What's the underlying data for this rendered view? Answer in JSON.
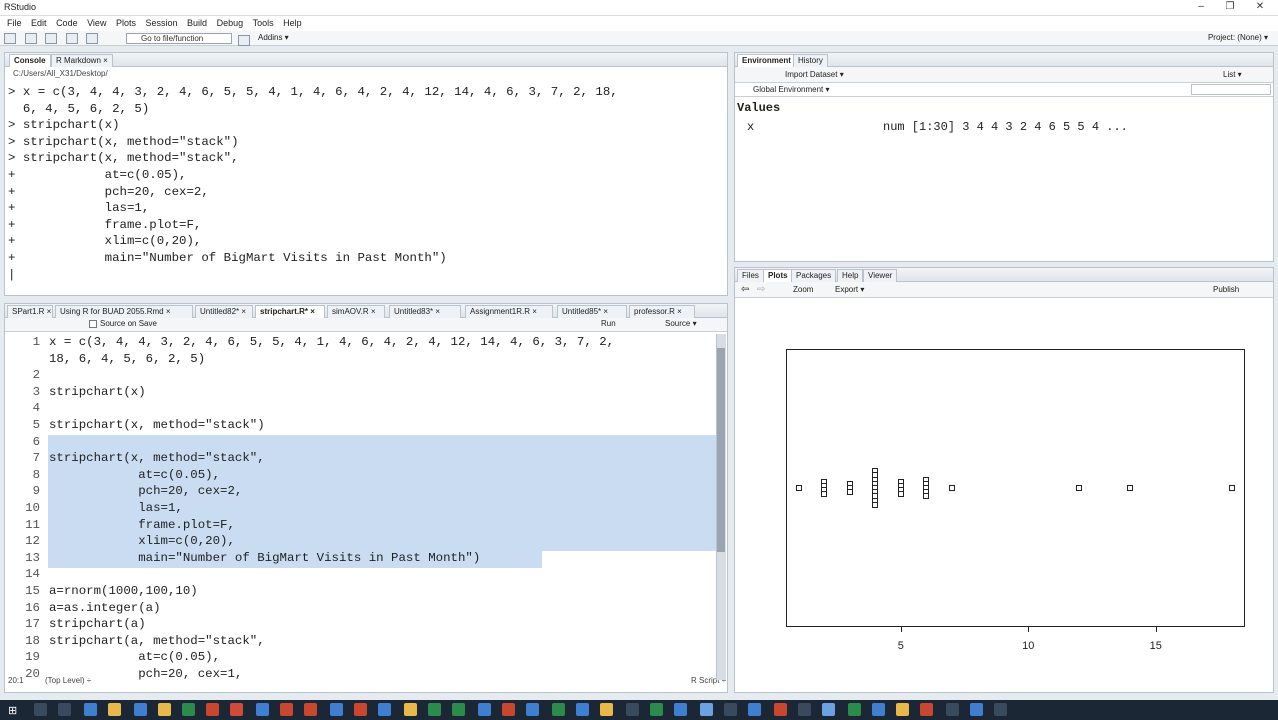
{
  "window": {
    "title": "RStudio",
    "minimize": "–",
    "maximize": "❐",
    "close": "✕"
  },
  "menu": [
    "File",
    "Edit",
    "Code",
    "View",
    "Plots",
    "Session",
    "Build",
    "Debug",
    "Tools",
    "Help"
  ],
  "toolbar": {
    "goto_label": "Go to file/function",
    "addins_label": "Addins ▾",
    "projects_label": "Project: (None) ▾"
  },
  "console": {
    "tabs": [
      "Console",
      "R Markdown ×"
    ],
    "path": "C:/Users/All_X31/Desktop/",
    "lines": [
      "> x = c(3, 4, 4, 3, 2, 4, 6, 5, 5, 4, 1, 4, 6, 4, 2, 4, 12, 14, 4, 6, 3, 7, 2, 18,",
      "  6, 4, 5, 6, 2, 5)",
      "> stripchart(x)",
      "> stripchart(x, method=\"stack\")",
      "> stripchart(x, method=\"stack\",",
      "+            at=c(0.05),",
      "+            pch=20, cex=2,",
      "+            las=1,",
      "+            frame.plot=F,",
      "+            xlim=c(0,20),",
      "+            main=\"Number of BigMart Visits in Past Month\")",
      "|"
    ]
  },
  "editor": {
    "tabs": [
      "SPart1.R ×",
      "Using R for BUAD 2055.Rmd ×",
      "Untitled82* ×",
      "stripchart.R* ×",
      "simAOV.R ×",
      "Untitled83* ×",
      "Assignment1R.R ×",
      "Untitled85* ×",
      "professor.R ×"
    ],
    "source_on_save": "Source on Save",
    "run_label": "Run",
    "source_label": "Source ▾",
    "line_numbers": [
      "1",
      "",
      "2",
      "3",
      "4",
      "5",
      "6",
      "7",
      "8",
      "9",
      "10",
      "11",
      "12",
      "13",
      "14",
      "15",
      "16",
      "17",
      "18",
      "19",
      "20"
    ],
    "lines": [
      "x = c(3, 4, 4, 3, 2, 4, 6, 5, 5, 4, 1, 4, 6, 4, 2, 4, 12, 14, 4, 6, 3, 7, 2,",
      "18, 6, 4, 5, 6, 2, 5)",
      "",
      "stripchart(x)",
      "",
      "stripchart(x, method=\"stack\")",
      "",
      "stripchart(x, method=\"stack\",",
      "            at=c(0.05),",
      "            pch=20, cex=2,",
      "            las=1,",
      "            frame.plot=F,",
      "            xlim=c(0,20),",
      "            main=\"Number of BigMart Visits in Past Month\")",
      "",
      "a=rnorm(1000,100,10)",
      "a=as.integer(a)",
      "stripchart(a)",
      "stripchart(a, method=\"stack\",",
      "            at=c(0.05),",
      "            pch=20, cex=1,"
    ],
    "status_left": "20:1",
    "status_mid": "(Top Level) ÷",
    "status_right": "R Script ÷"
  },
  "environment": {
    "tabs": [
      "Environment",
      "History"
    ],
    "import_label": "Import Dataset ▾",
    "list_label": "List ▾",
    "scope": "Global Environment ▾",
    "section": "Values",
    "var_name": "x",
    "var_value": "num [1:30] 3 4 4 3 2 4 6 5 5 4 ..."
  },
  "plots": {
    "tabs": [
      "Files",
      "Plots",
      "Packages",
      "Help",
      "Viewer"
    ],
    "zoom_label": "Zoom",
    "export_label": "Export ▾",
    "publish_label": "Publish"
  },
  "chart_data": {
    "type": "scatter",
    "title": "",
    "xlabel": "",
    "ylabel": "",
    "xlim": [
      0.5,
      18.5
    ],
    "ticks": [
      5,
      10,
      15
    ],
    "tick_labels": [
      "5",
      "10",
      "15"
    ],
    "method": "stack",
    "values": [
      3,
      4,
      4,
      3,
      2,
      4,
      6,
      5,
      5,
      4,
      1,
      4,
      6,
      4,
      2,
      4,
      12,
      14,
      4,
      6,
      3,
      7,
      2,
      18,
      6,
      4,
      5,
      6,
      2,
      5
    ]
  }
}
